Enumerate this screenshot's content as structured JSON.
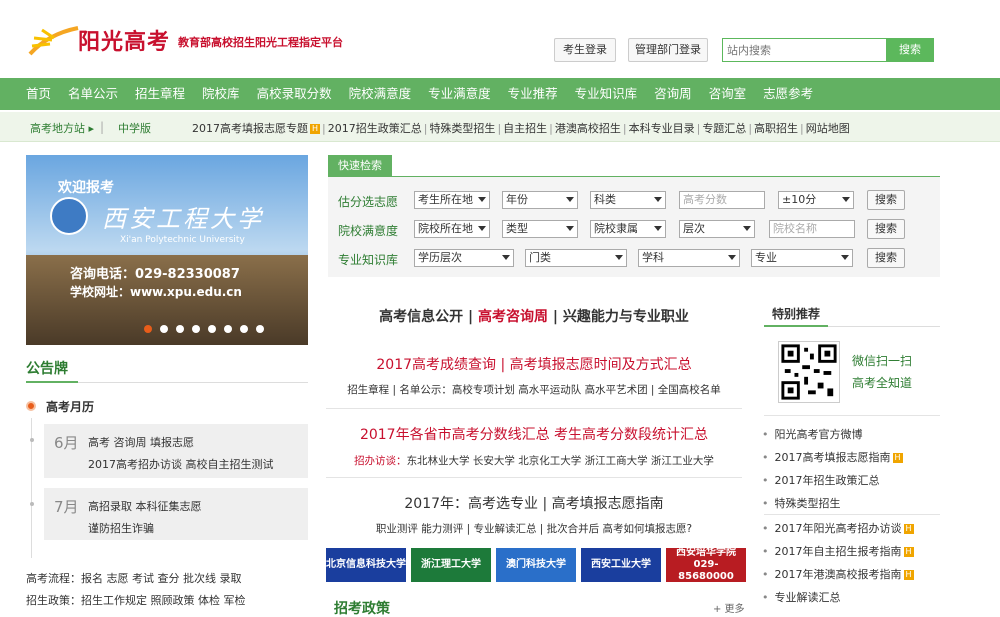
{
  "header": {
    "logo_text": "阳光高考",
    "tagline": "教育部高校招生阳光工程指定平台",
    "student_login": "考生登录",
    "admin_login": "管理部门登录",
    "search_placeholder": "站内搜索",
    "search_button": "搜索"
  },
  "nav": [
    "首页",
    "名单公示",
    "招生章程",
    "院校库",
    "高校录取分数",
    "院校满意度",
    "专业满意度",
    "专业推荐",
    "专业知识库",
    "咨询周",
    "咨询室",
    "志愿参考"
  ],
  "subnav": {
    "region": "高考地方站",
    "middle": "中学版",
    "links": [
      {
        "text": "2017高考填报志愿专题",
        "hot": true
      },
      {
        "text": "2017招生政策汇总",
        "hot": false
      },
      {
        "text": "特殊类型招生",
        "hot": false
      },
      {
        "text": "自主招生",
        "hot": false
      },
      {
        "text": "港澳高校招生",
        "hot": false
      },
      {
        "text": "本科专业目录",
        "hot": false
      },
      {
        "text": "专题汇总",
        "hot": false
      },
      {
        "text": "高职招生",
        "hot": false
      },
      {
        "text": "网站地图",
        "hot": false
      }
    ]
  },
  "banner": {
    "welcome": "欢迎报考",
    "school": "西安工程大学",
    "english": "Xi'an Polytechnic University",
    "tel": "咨询电话：029-82330087",
    "web": "学校网址：www.xpu.edu.cn"
  },
  "notice": {
    "title": "公告牌",
    "calendar": "高考月历",
    "months": [
      {
        "month": "6月",
        "lines": [
          "高考  咨询周  填报志愿",
          "2017高考招办访谈  高校自主招生测试"
        ]
      },
      {
        "month": "7月",
        "lines": [
          "高招录取  本科征集志愿",
          "谨防招生诈骗"
        ]
      }
    ],
    "flow1": "高考流程：报名  志愿  考试  查分  批次线  录取",
    "flow2": "招生政策：招生工作规定  照顾政策  体检  军检"
  },
  "quick_search": {
    "tab": "快速检索",
    "button": "搜索",
    "rows": [
      {
        "label": "估分选志愿",
        "fields": [
          {
            "t": "sel",
            "v": "考生所在地"
          },
          {
            "t": "sel",
            "v": "年份"
          },
          {
            "t": "sel",
            "v": "科类"
          },
          {
            "t": "inp",
            "v": "高考分数"
          },
          {
            "t": "sel",
            "v": "±10分"
          }
        ]
      },
      {
        "label": "院校满意度",
        "fields": [
          {
            "t": "sel",
            "v": "院校所在地"
          },
          {
            "t": "sel",
            "v": "类型"
          },
          {
            "t": "sel",
            "v": "院校隶属"
          },
          {
            "t": "sel",
            "v": "层次"
          },
          {
            "t": "inp",
            "v": "院校名称"
          }
        ]
      },
      {
        "label": "专业知识库",
        "fields": [
          {
            "t": "sel",
            "v": "学历层次"
          },
          {
            "t": "sel",
            "v": "门类"
          },
          {
            "t": "sel",
            "v": "学科"
          },
          {
            "t": "sel",
            "v": "专业"
          }
        ]
      }
    ]
  },
  "center": {
    "headline_a": "高考信息公开",
    "headline_b": "高考咨询周",
    "headline_c": "兴趣能力与专业职业",
    "block1_title": "2017高考成绩查询 | 高考填报志愿时间及方式汇总",
    "block1_sub": "招生章程 | 名单公示：高校专项计划  高水平运动队  高水平艺术团 | 全国高校名单",
    "block2_title": "2017年各省市高考分数线汇总  考生高考分数段统计汇总",
    "block2_sub_red": "招办访谈：",
    "block2_sub": "东北林业大学  长安大学  北京化工大学  浙江工商大学  浙江工业大学",
    "block3_title": "2017年：高考选专业 | 高考填报志愿指南",
    "block3_sub": "职业测评  能力测评 | 专业解读汇总 | 批次合并后  高考如何填报志愿?",
    "logos": [
      "北京信息科技大学",
      "浙江理工大学",
      "澳门科技大学",
      "西安工业大学",
      "西安培华学院 029-85680000"
    ],
    "policy_title": "招考政策",
    "more": "+ 更多"
  },
  "right": {
    "title": "特别推荐",
    "qr_line1": "微信扫一扫",
    "qr_line2": "高考全知道",
    "list1": [
      {
        "text": "阳光高考官方微博",
        "hot": false
      },
      {
        "text": "2017高考填报志愿指南",
        "hot": true
      },
      {
        "text": "2017年招生政策汇总",
        "hot": false
      },
      {
        "text": "特殊类型招生",
        "hot": false
      }
    ],
    "list2": [
      {
        "text": "2017年阳光高考招办访谈",
        "hot": true
      },
      {
        "text": "2017年自主招生报考指南",
        "hot": true
      },
      {
        "text": "2017年港澳高校报考指南",
        "hot": true
      },
      {
        "text": "专业解读汇总",
        "hot": false
      }
    ]
  },
  "colors": {
    "brand_green": "#62b162",
    "brand_red": "#c8102e",
    "accent_orange": "#e85d1a"
  }
}
